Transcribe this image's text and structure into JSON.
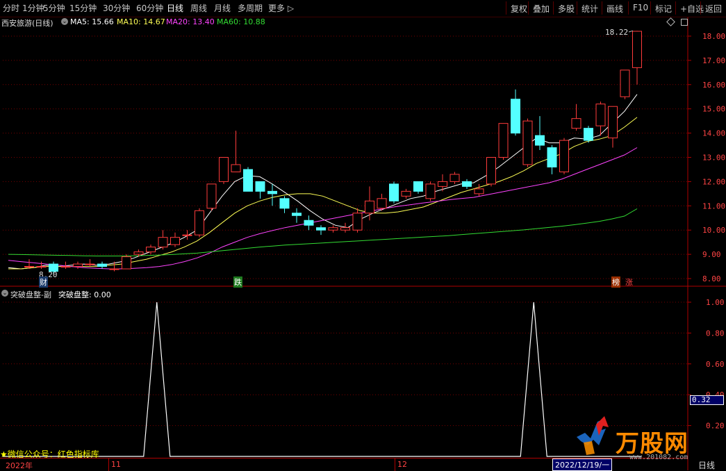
{
  "toolbar": {
    "periods": [
      "分时",
      "1分钟",
      "5分钟",
      "15分钟",
      "30分钟",
      "60分钟",
      "日线",
      "周线",
      "月线",
      "多周期",
      "更多"
    ],
    "active_period": "日线",
    "right_buttons": [
      "复权",
      "叠加",
      "多股",
      "统计",
      "画线",
      "F10",
      "标记",
      "+自选",
      "返回"
    ]
  },
  "stock": {
    "name": "西安旅游(日线)"
  },
  "ma_legend": [
    {
      "label": "MA5: 15.66",
      "color": "#ffffff"
    },
    {
      "label": "MA10: 14.67",
      "color": "#ffff55"
    },
    {
      "label": "MA20: 13.40",
      "color": "#ff44ff"
    },
    {
      "label": "MA60: 10.88",
      "color": "#33dd33"
    }
  ],
  "indicator": {
    "title": "突破盘整-副",
    "value_label": "突破盘整: 0.00"
  },
  "annotations": {
    "high_label": "18.22",
    "low_label": "8.20",
    "marker_cai": "财",
    "marker_die": "跌",
    "marker_bang": "榜",
    "marker_zhang": "涨",
    "cursor_value": "0.32",
    "bottom_right_period": "日线",
    "wechat_note": "★微信公众号：红色指标库"
  },
  "time_axis": {
    "labels": [
      "2022年",
      "11",
      "12",
      "2022/12/19/一"
    ]
  },
  "watermark": {
    "brand": "万股网",
    "url": "www.201082.com"
  },
  "colors": {
    "up": "#ff3b3b",
    "down": "#54ffff",
    "grid": "#7a0000",
    "axis": "#b00000",
    "ma5": "#ffffff",
    "ma10": "#ffff55",
    "ma20": "#ff44ff",
    "ma60": "#33dd33",
    "ind_line": "#ffffff"
  },
  "chart_data": [
    {
      "type": "candlestick",
      "title": "西安旅游(日线)",
      "y_ticks": [
        8.0,
        9.0,
        10.0,
        11.0,
        12.0,
        13.0,
        14.0,
        15.0,
        16.0,
        17.0,
        18.0
      ],
      "ylim": [
        7.8,
        18.6
      ],
      "candles": [
        {
          "o": 8.5,
          "c": 8.5,
          "h": 8.8,
          "l": 8.4
        },
        {
          "o": 8.5,
          "c": 8.5,
          "h": 8.7,
          "l": 8.4
        },
        {
          "o": 8.6,
          "c": 8.3,
          "h": 8.7,
          "l": 8.2
        },
        {
          "o": 8.5,
          "c": 8.5,
          "h": 8.7,
          "l": 8.4
        },
        {
          "o": 8.5,
          "c": 8.6,
          "h": 8.7,
          "l": 8.4
        },
        {
          "o": 8.6,
          "c": 8.6,
          "h": 8.8,
          "l": 8.5
        },
        {
          "o": 8.6,
          "c": 8.5,
          "h": 8.7,
          "l": 8.4
        },
        {
          "o": 8.4,
          "c": 8.4,
          "h": 8.7,
          "l": 8.3
        },
        {
          "o": 8.4,
          "c": 8.9,
          "h": 9.0,
          "l": 8.4
        },
        {
          "o": 9.0,
          "c": 9.1,
          "h": 9.2,
          "l": 8.9
        },
        {
          "o": 9.1,
          "c": 9.3,
          "h": 9.4,
          "l": 9.0
        },
        {
          "o": 9.3,
          "c": 9.7,
          "h": 10.0,
          "l": 9.2
        },
        {
          "o": 9.4,
          "c": 9.7,
          "h": 9.9,
          "l": 9.3
        },
        {
          "o": 9.8,
          "c": 9.8,
          "h": 10.0,
          "l": 9.6
        },
        {
          "o": 9.8,
          "c": 10.8,
          "h": 10.9,
          "l": 9.7
        },
        {
          "o": 10.9,
          "c": 11.9,
          "h": 11.9,
          "l": 10.8
        },
        {
          "o": 12.0,
          "c": 13.0,
          "h": 13.0,
          "l": 11.9
        },
        {
          "o": 12.4,
          "c": 12.7,
          "h": 14.1,
          "l": 12.4
        },
        {
          "o": 12.5,
          "c": 11.6,
          "h": 12.6,
          "l": 11.6
        },
        {
          "o": 12.0,
          "c": 11.6,
          "h": 12.0,
          "l": 11.3
        },
        {
          "o": 11.6,
          "c": 11.5,
          "h": 11.9,
          "l": 11.0
        },
        {
          "o": 11.3,
          "c": 10.9,
          "h": 11.4,
          "l": 10.7
        },
        {
          "o": 10.7,
          "c": 10.6,
          "h": 10.9,
          "l": 10.3
        },
        {
          "o": 10.4,
          "c": 10.2,
          "h": 10.6,
          "l": 10.0
        },
        {
          "o": 10.1,
          "c": 10.0,
          "h": 10.2,
          "l": 9.8
        },
        {
          "o": 10.0,
          "c": 10.1,
          "h": 10.2,
          "l": 9.9
        },
        {
          "o": 10.0,
          "c": 10.1,
          "h": 10.3,
          "l": 9.9
        },
        {
          "o": 10.0,
          "c": 10.7,
          "h": 10.9,
          "l": 9.9
        },
        {
          "o": 10.7,
          "c": 11.2,
          "h": 11.8,
          "l": 10.4
        },
        {
          "o": 10.9,
          "c": 11.3,
          "h": 11.5,
          "l": 10.8
        },
        {
          "o": 11.9,
          "c": 11.2,
          "h": 12.0,
          "l": 11.1
        },
        {
          "o": 11.4,
          "c": 11.6,
          "h": 11.7,
          "l": 11.3
        },
        {
          "o": 12.0,
          "c": 11.6,
          "h": 12.0,
          "l": 11.5
        },
        {
          "o": 11.3,
          "c": 11.9,
          "h": 12.0,
          "l": 11.2
        },
        {
          "o": 11.8,
          "c": 12.0,
          "h": 12.3,
          "l": 11.6
        },
        {
          "o": 12.0,
          "c": 12.3,
          "h": 12.4,
          "l": 11.9
        },
        {
          "o": 12.0,
          "c": 11.8,
          "h": 12.1,
          "l": 11.7
        },
        {
          "o": 11.5,
          "c": 11.7,
          "h": 11.9,
          "l": 11.4
        },
        {
          "o": 11.9,
          "c": 13.0,
          "h": 13.0,
          "l": 11.8
        },
        {
          "o": 13.0,
          "c": 14.4,
          "h": 14.4,
          "l": 12.9
        },
        {
          "o": 15.4,
          "c": 14.0,
          "h": 15.8,
          "l": 13.9
        },
        {
          "o": 12.7,
          "c": 14.5,
          "h": 14.6,
          "l": 12.6
        },
        {
          "o": 13.9,
          "c": 13.5,
          "h": 14.7,
          "l": 13.3
        },
        {
          "o": 13.4,
          "c": 12.6,
          "h": 13.5,
          "l": 12.3
        },
        {
          "o": 12.4,
          "c": 13.7,
          "h": 13.8,
          "l": 12.3
        },
        {
          "o": 14.2,
          "c": 14.6,
          "h": 15.2,
          "l": 14.1
        },
        {
          "o": 14.2,
          "c": 13.7,
          "h": 14.3,
          "l": 13.6
        },
        {
          "o": 14.3,
          "c": 15.2,
          "h": 15.3,
          "l": 13.9
        },
        {
          "o": 13.8,
          "c": 15.1,
          "h": 15.1,
          "l": 13.4
        },
        {
          "o": 15.5,
          "c": 16.6,
          "h": 16.6,
          "l": 15.4
        },
        {
          "o": 16.7,
          "c": 18.2,
          "h": 18.22,
          "l": 16.0
        }
      ],
      "ma_series": [
        {
          "name": "MA5",
          "first_index": 0,
          "values": [
            8.45,
            8.4,
            8.45,
            8.55,
            8.5,
            8.55,
            8.6,
            8.55,
            8.6,
            8.7,
            8.85,
            9.05,
            9.25,
            9.45,
            9.7,
            10.0,
            10.7,
            11.4,
            12.0,
            12.25,
            12.2,
            11.9,
            11.55,
            11.2,
            10.8,
            10.45,
            10.2,
            10.1,
            10.45,
            10.7,
            10.9,
            11.1,
            11.3,
            11.4,
            11.6,
            11.75,
            11.9,
            11.95,
            12.25,
            12.6,
            13.0,
            13.4,
            13.8,
            13.6,
            13.6,
            13.8,
            13.75,
            13.9,
            14.4,
            14.9,
            15.6
          ]
        },
        {
          "name": "MA10",
          "first_index": 0,
          "values": [
            8.4,
            8.4,
            8.45,
            8.5,
            8.5,
            8.5,
            8.5,
            8.5,
            8.55,
            8.6,
            8.7,
            8.8,
            8.95,
            9.1,
            9.3,
            9.55,
            9.9,
            10.3,
            10.7,
            11.0,
            11.2,
            11.35,
            11.45,
            11.5,
            11.5,
            11.4,
            11.2,
            11.0,
            10.8,
            10.7,
            10.7,
            10.75,
            10.85,
            10.95,
            11.15,
            11.35,
            11.55,
            11.7,
            11.85,
            12.0,
            12.2,
            12.45,
            12.75,
            12.95,
            13.15,
            13.45,
            13.65,
            13.75,
            13.9,
            14.25,
            14.65
          ]
        },
        {
          "name": "MA20",
          "first_index": 0,
          "values": [
            8.75,
            8.7,
            8.65,
            8.6,
            8.55,
            8.5,
            8.45,
            8.42,
            8.4,
            8.4,
            8.42,
            8.45,
            8.5,
            8.58,
            8.7,
            8.85,
            9.05,
            9.3,
            9.5,
            9.7,
            9.85,
            9.98,
            10.1,
            10.2,
            10.3,
            10.4,
            10.5,
            10.6,
            10.7,
            10.8,
            10.9,
            10.98,
            11.05,
            11.12,
            11.18,
            11.25,
            11.3,
            11.35,
            11.45,
            11.55,
            11.65,
            11.75,
            11.85,
            11.95,
            12.1,
            12.3,
            12.5,
            12.7,
            12.9,
            13.1,
            13.4
          ]
        },
        {
          "name": "MA60",
          "first_index": 0,
          "values": [
            9.0,
            8.99,
            8.98,
            8.97,
            8.96,
            8.95,
            8.94,
            8.93,
            8.93,
            8.93,
            8.94,
            8.95,
            8.97,
            8.99,
            9.02,
            9.05,
            9.1,
            9.15,
            9.2,
            9.25,
            9.3,
            9.34,
            9.38,
            9.41,
            9.44,
            9.47,
            9.5,
            9.53,
            9.56,
            9.59,
            9.62,
            9.65,
            9.68,
            9.71,
            9.74,
            9.77,
            9.81,
            9.85,
            9.89,
            9.93,
            9.97,
            10.01,
            10.06,
            10.11,
            10.16,
            10.22,
            10.29,
            10.36,
            10.46,
            10.58,
            10.88
          ]
        }
      ]
    },
    {
      "type": "line",
      "title": "突破盘整-副",
      "y_ticks": [
        0.2,
        0.4,
        0.6,
        0.8,
        1.0
      ],
      "ylim": [
        0,
        1.05
      ],
      "series": [
        {
          "name": "突破盘整",
          "spikes": [
            {
              "index": 10,
              "value": 1.0
            },
            {
              "index": 41,
              "value": 1.0
            }
          ],
          "baseline": 0
        }
      ]
    }
  ]
}
